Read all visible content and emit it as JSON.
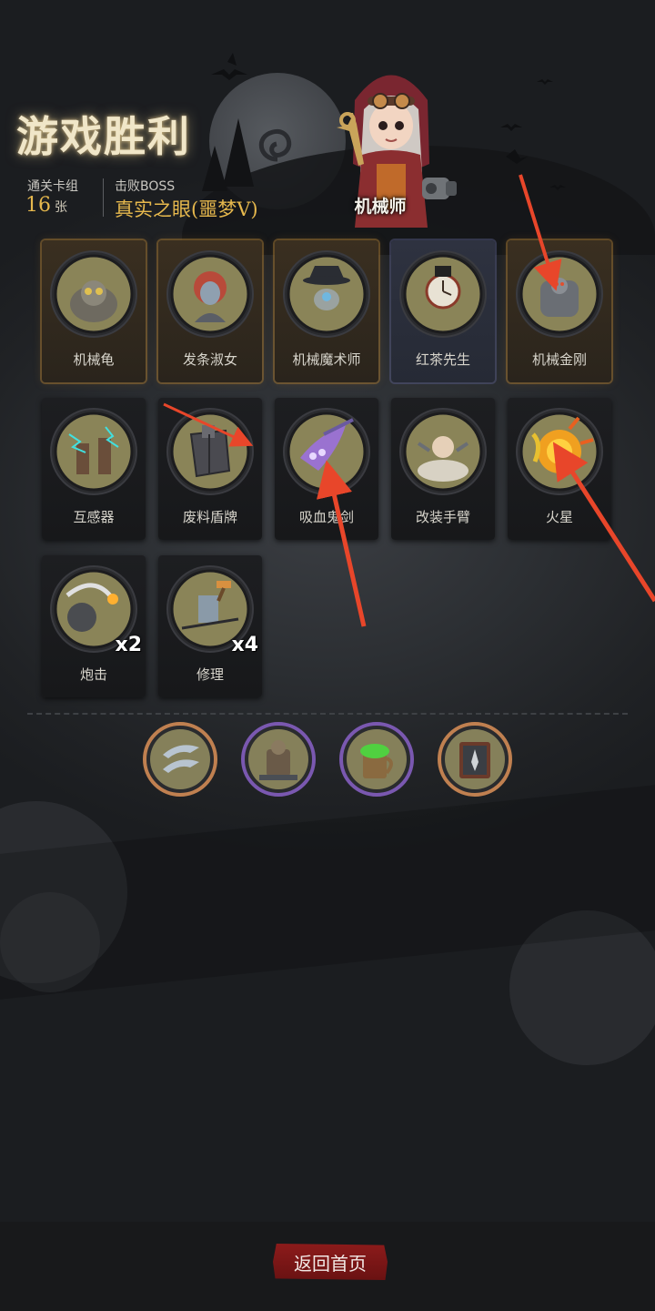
{
  "header": {
    "title": "游戏胜利",
    "deck_label": "通关卡组",
    "deck_count": "16",
    "deck_unit": "张",
    "boss_label": "击败BOSS",
    "boss_name": "真实之眼(噩梦V)"
  },
  "character": {
    "name": "机械师"
  },
  "cards": [
    {
      "name": "机械龟",
      "rarity": "gold"
    },
    {
      "name": "发条淑女",
      "rarity": "gold"
    },
    {
      "name": "机械魔术师",
      "rarity": "gold"
    },
    {
      "name": "红茶先生",
      "rarity": "blue"
    },
    {
      "name": "机械金刚",
      "rarity": "gold"
    },
    {
      "name": "互感器",
      "rarity": "normal"
    },
    {
      "name": "废料盾牌",
      "rarity": "normal"
    },
    {
      "name": "吸血鬼剑",
      "rarity": "normal"
    },
    {
      "name": "改装手臂",
      "rarity": "normal"
    },
    {
      "name": "火星",
      "rarity": "normal"
    },
    {
      "name": "炮击",
      "rarity": "normal",
      "count": "x2"
    },
    {
      "name": "修理",
      "rarity": "normal",
      "count": "x4"
    }
  ],
  "relics": [
    {
      "icon": "claw-blades-icon",
      "border": "#c08050"
    },
    {
      "icon": "mech-robot-icon",
      "border": "#7a58b0"
    },
    {
      "icon": "poison-mug-icon",
      "border": "#7a58b0"
    },
    {
      "icon": "spellbook-icon",
      "border": "#c08050"
    }
  ],
  "footer": {
    "home_button": "返回首页"
  },
  "colors": {
    "title_glow": "#f0e6c8",
    "value_gold": "#e6b84d",
    "button_red": "#8c1b1b",
    "annotation_arrow": "#e8462a"
  }
}
